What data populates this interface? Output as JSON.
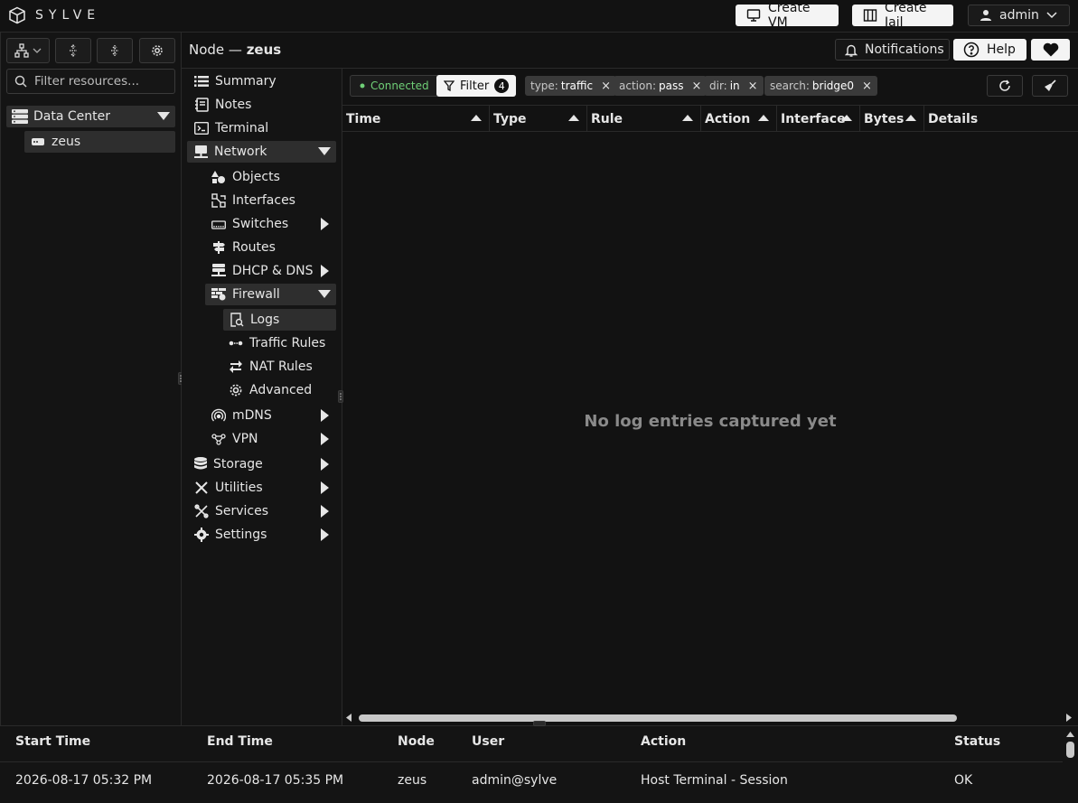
{
  "app": {
    "logo_text": "SYLVE"
  },
  "topbar": {
    "create_vm": "Create VM",
    "create_jail": "Create Jail",
    "user": "admin"
  },
  "left": {
    "filter_placeholder": "Filter resources...",
    "tree": {
      "datacenter": "Data Center",
      "node": "zeus"
    }
  },
  "node_header": {
    "prefix": "Node —",
    "name": "zeus",
    "notifications": "Notifications",
    "help": "Help"
  },
  "nav": {
    "summary": "Summary",
    "notes": "Notes",
    "terminal": "Terminal",
    "network": "Network",
    "objects": "Objects",
    "interfaces": "Interfaces",
    "switches": "Switches",
    "routes": "Routes",
    "dhcp": "DHCP & DNS",
    "firewall": "Firewall",
    "logs": "Logs",
    "traffic_rules": "Traffic Rules",
    "nat_rules": "NAT Rules",
    "advanced": "Advanced",
    "mdns": "mDNS",
    "vpn": "VPN",
    "storage": "Storage",
    "utilities": "Utilities",
    "services": "Services",
    "settings": "Settings"
  },
  "logs": {
    "status": "Connected",
    "filter_label": "Filter",
    "filter_count": "4",
    "chips": [
      {
        "key": "type:",
        "value": "traffic"
      },
      {
        "key": "action:",
        "value": "pass"
      },
      {
        "key": "dir:",
        "value": "in"
      },
      {
        "key": "search:",
        "value": "bridge0"
      }
    ],
    "columns": [
      "Time",
      "Type",
      "Rule",
      "Action",
      "Interface",
      "Bytes",
      "Details"
    ],
    "empty_message": "No log entries captured yet"
  },
  "tasks": {
    "columns": [
      "Start Time",
      "End Time",
      "Node",
      "User",
      "Action",
      "Status"
    ],
    "rows": [
      [
        "2026-08-17 05:32 PM",
        "2026-08-17 05:35 PM",
        "zeus",
        "admin@sylve",
        "Host Terminal - Session",
        "OK"
      ]
    ]
  },
  "colors": {
    "accent_green": "#6fcf77",
    "background": "#121212",
    "panel": "#141414"
  }
}
